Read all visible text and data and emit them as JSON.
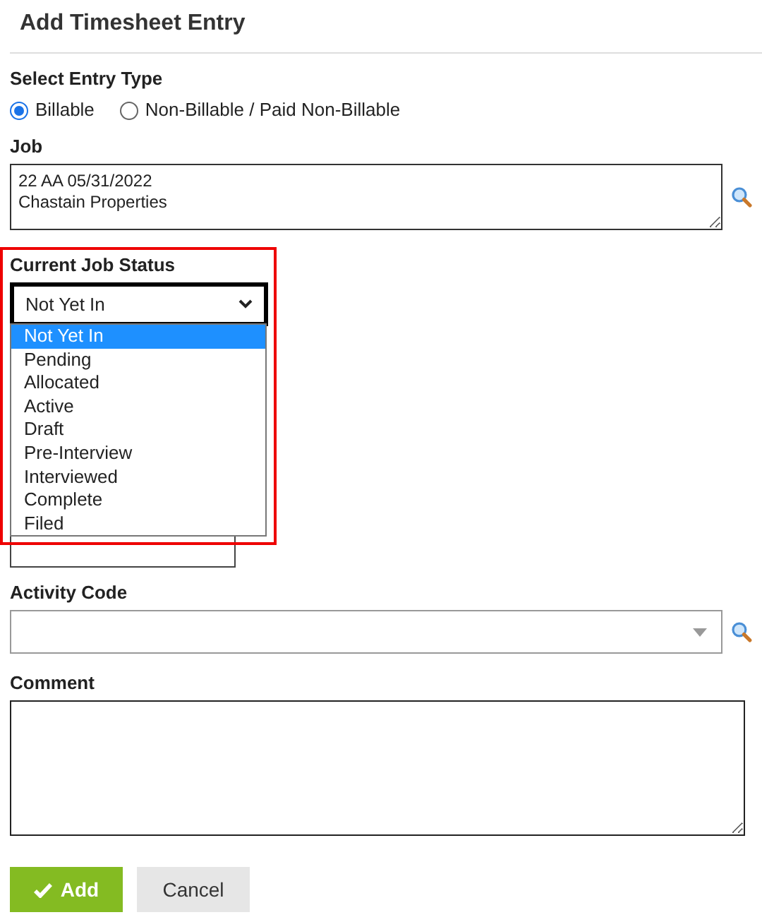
{
  "title": "Add Timesheet Entry",
  "entry_type": {
    "label": "Select Entry Type",
    "options": [
      {
        "label": "Billable",
        "selected": true
      },
      {
        "label": "Non-Billable / Paid Non-Billable",
        "selected": false
      }
    ]
  },
  "job": {
    "label": "Job",
    "value": "22 AA 05/31/2022\nChastain Properties"
  },
  "job_status": {
    "label": "Current Job Status",
    "value": "Not Yet In",
    "expanded": true,
    "options": [
      {
        "label": "Not Yet In",
        "selected": true
      },
      {
        "label": "Pending",
        "selected": false
      },
      {
        "label": "Allocated",
        "selected": false
      },
      {
        "label": "Active",
        "selected": false
      },
      {
        "label": "Draft",
        "selected": false
      },
      {
        "label": "Pre-Interview",
        "selected": false
      },
      {
        "label": "Interviewed",
        "selected": false
      },
      {
        "label": "Complete",
        "selected": false
      },
      {
        "label": "Filed",
        "selected": false
      }
    ]
  },
  "activity_code": {
    "label": "Activity Code"
  },
  "comment": {
    "label": "Comment"
  },
  "buttons": [
    {
      "label": "Add",
      "kind": "primary"
    },
    {
      "label": "Cancel",
      "kind": "secondary"
    }
  ]
}
